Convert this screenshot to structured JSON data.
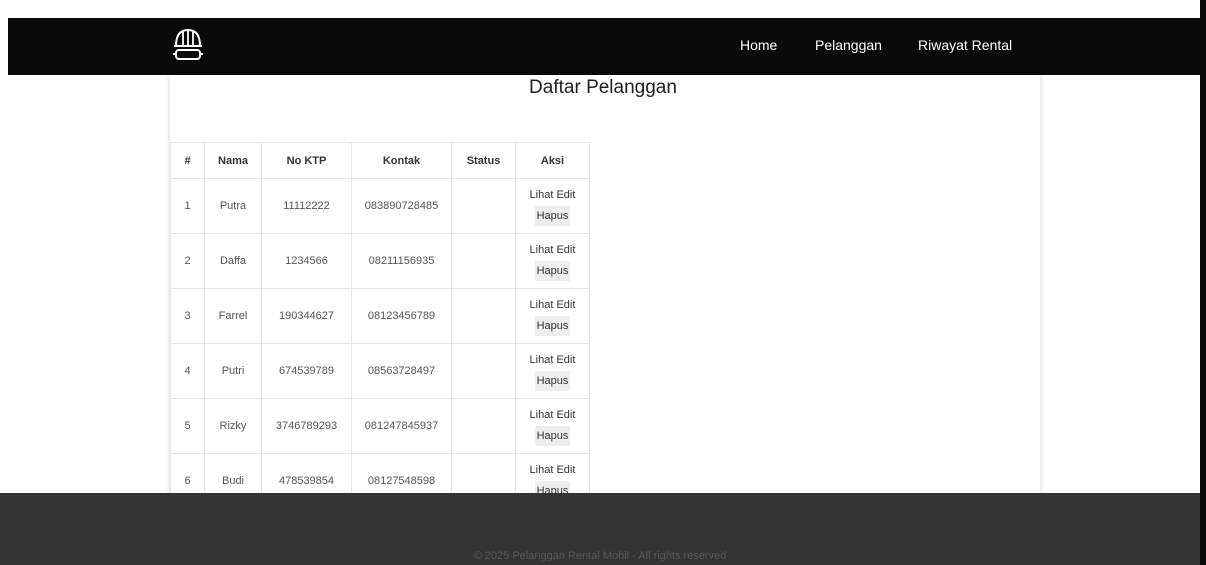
{
  "nav": {
    "links": [
      "Home",
      "Pelanggan",
      "Riwayat Rental"
    ]
  },
  "page": {
    "title": "Daftar Pelanggan"
  },
  "table": {
    "headers": [
      "#",
      "Nama",
      "No KTP",
      "Kontak",
      "Status",
      "Aksi"
    ],
    "rows": [
      {
        "no": "1",
        "nama": "Putra",
        "ktp": "11112222",
        "kontak": "083890728485",
        "status": ""
      },
      {
        "no": "2",
        "nama": "Daffa",
        "ktp": "1234566",
        "kontak": "08211156935",
        "status": ""
      },
      {
        "no": "3",
        "nama": "Farrel",
        "ktp": "190344627",
        "kontak": "08123456789",
        "status": ""
      },
      {
        "no": "4",
        "nama": "Putri",
        "ktp": "674539789",
        "kontak": "08563728497",
        "status": ""
      },
      {
        "no": "5",
        "nama": "Rizky",
        "ktp": "3746789293",
        "kontak": "081247845937",
        "status": ""
      },
      {
        "no": "6",
        "nama": "Budi",
        "ktp": "478539854",
        "kontak": "08127548598",
        "status": ""
      }
    ],
    "actions": {
      "view": "Lihat",
      "edit": "Edit",
      "delete": "Hapus"
    }
  },
  "footer": {
    "text": "© 2025 Pelanggan Rental Mobil - All rights reserved"
  },
  "icons": {
    "logo": "helmet-goggles-icon"
  },
  "colors": {
    "navbar": "#0a0a0a",
    "footer": "#333333",
    "footer_text": "#5a5a5a"
  }
}
